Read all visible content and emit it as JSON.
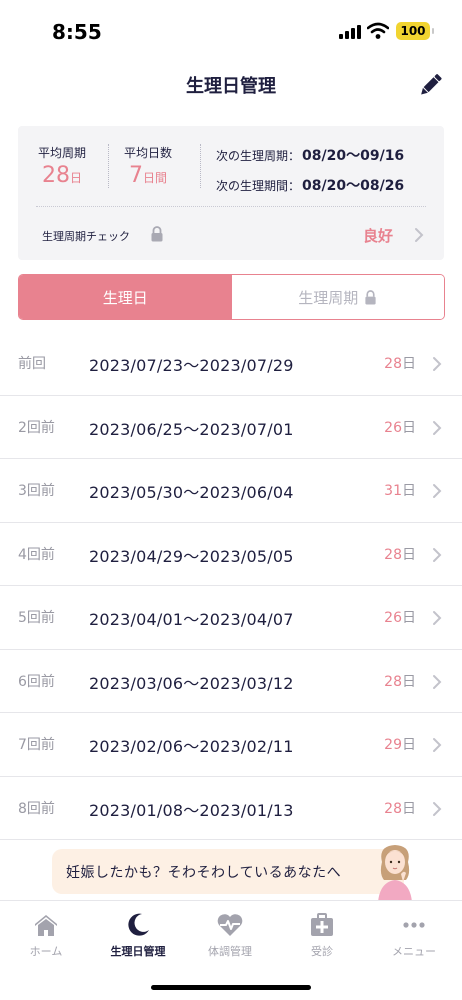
{
  "status_bar": {
    "time": "8:55",
    "battery": "100"
  },
  "header": {
    "title": "生理日管理",
    "edit_icon": "pencil-icon"
  },
  "summary": {
    "avg_cycle_label": "平均周期",
    "avg_cycle_value": "28",
    "avg_cycle_unit": "日",
    "avg_days_label": "平均日数",
    "avg_days_value": "7",
    "avg_days_unit": "日間",
    "next_cycle_label": "次の生理周期：",
    "next_cycle_value": "08/20〜09/16",
    "next_period_label": "次の生理期間：",
    "next_period_value": "08/20〜08/26",
    "check_label": "生理周期チェック",
    "check_value": "良好"
  },
  "tabs": [
    {
      "label": "生理日",
      "active": true
    },
    {
      "label": "生理周期",
      "active": false,
      "locked": true
    }
  ],
  "history": [
    {
      "label": "前回",
      "range": "2023/07/23〜2023/07/29",
      "days": "28",
      "unit": "日"
    },
    {
      "label": "2回前",
      "range": "2023/06/25〜2023/07/01",
      "days": "26",
      "unit": "日"
    },
    {
      "label": "3回前",
      "range": "2023/05/30〜2023/06/04",
      "days": "31",
      "unit": "日"
    },
    {
      "label": "4回前",
      "range": "2023/04/29〜2023/05/05",
      "days": "28",
      "unit": "日"
    },
    {
      "label": "5回前",
      "range": "2023/04/01〜2023/04/07",
      "days": "26",
      "unit": "日"
    },
    {
      "label": "6回前",
      "range": "2023/03/06〜2023/03/12",
      "days": "28",
      "unit": "日"
    },
    {
      "label": "7回前",
      "range": "2023/02/06〜2023/02/11",
      "days": "29",
      "unit": "日"
    },
    {
      "label": "8回前",
      "range": "2023/01/08〜2023/01/13",
      "days": "28",
      "unit": "日"
    }
  ],
  "banner": {
    "text": "妊娠したかも？そわそわしているあなたへ"
  },
  "bottom_nav": [
    {
      "label": "ホーム",
      "icon": "home-icon",
      "active": false
    },
    {
      "label": "生理日管理",
      "icon": "moon-icon",
      "active": true
    },
    {
      "label": "体調管理",
      "icon": "heart-pulse-icon",
      "active": false
    },
    {
      "label": "受診",
      "icon": "medical-kit-icon",
      "active": false
    },
    {
      "label": "メニュー",
      "icon": "more-dots-icon",
      "active": false
    }
  ],
  "colors": {
    "accent": "#e8828f",
    "text": "#1f1f3f",
    "muted": "#9a9aa4",
    "card": "#f4f4f6",
    "banner": "#fdf0e4"
  }
}
